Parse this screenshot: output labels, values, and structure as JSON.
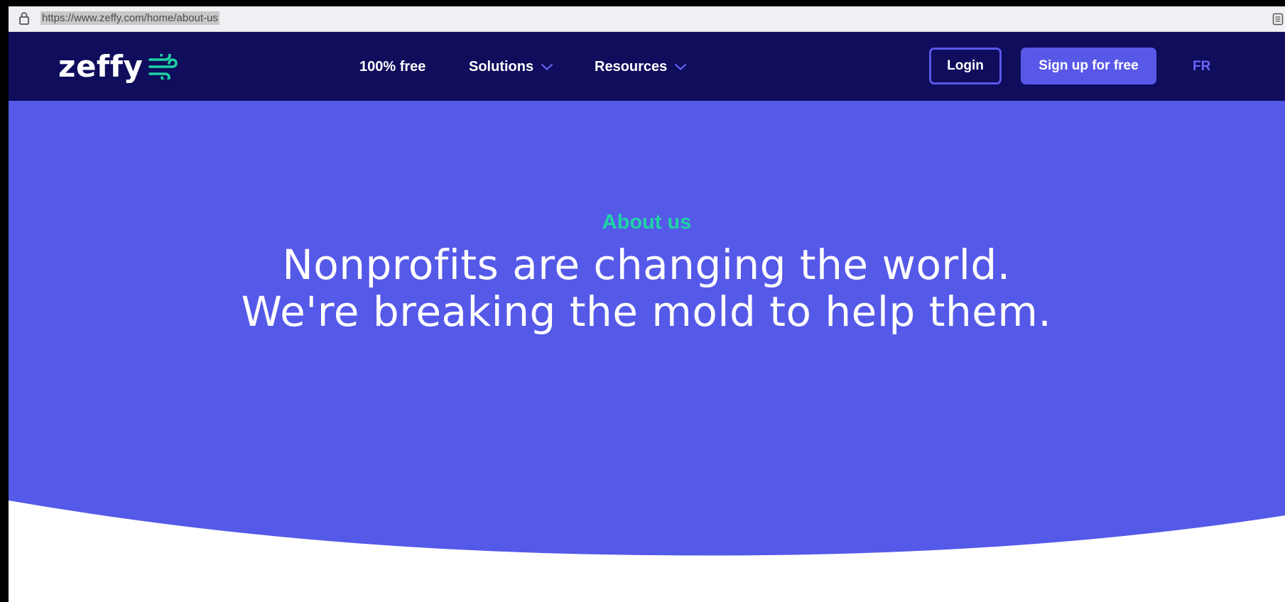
{
  "browser": {
    "url": "https://www.zeffy.com/home/about-us",
    "icons": [
      "lock-icon",
      "reader-mode-icon"
    ]
  },
  "nav": {
    "logo_text": "zeffy",
    "links": [
      {
        "label": "100% free"
      },
      {
        "label": "Solutions",
        "icon": "chevron-down-icon"
      },
      {
        "label": "Resources",
        "icon": "chevron-down-icon"
      }
    ],
    "login_label": "Login",
    "signup_label": "Sign up for free",
    "language_label": "FR"
  },
  "hero": {
    "eyebrow": "About us",
    "headline": "Nonprofits are changing the world. We're breaking the mold to help them."
  },
  "colors": {
    "nav_bg": "#0f0d5c",
    "hero_bg": "#5559e8",
    "accent_green": "#1fd3a5",
    "button_purple": "#5858e8",
    "language_link": "#6a66ff"
  }
}
